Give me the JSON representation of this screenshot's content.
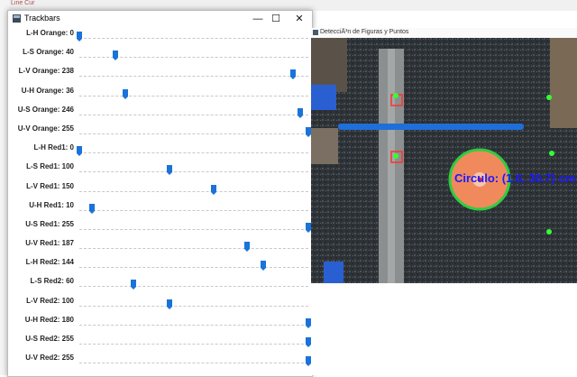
{
  "background": {
    "text": "Line  Cur"
  },
  "trackbars_window": {
    "title": "Trackbars",
    "controls": {
      "minimize": "—",
      "maximize": "☐",
      "close": "✕"
    },
    "sliders": [
      {
        "label": "L-H Orange: 0",
        "value": 0,
        "max": 179
      },
      {
        "label": "L-S Orange: 40",
        "value": 40,
        "max": 255
      },
      {
        "label": "L-V Orange: 238",
        "value": 238,
        "max": 255
      },
      {
        "label": "U-H Orange: 36",
        "value": 36,
        "max": 179
      },
      {
        "label": "U-S Orange: 246",
        "value": 246,
        "max": 255
      },
      {
        "label": "U-V Orange: 255",
        "value": 255,
        "max": 255
      },
      {
        "label": "L-H Red1: 0",
        "value": 0,
        "max": 179
      },
      {
        "label": "L-S Red1: 100",
        "value": 100,
        "max": 255
      },
      {
        "label": "L-V Red1: 150",
        "value": 150,
        "max": 255
      },
      {
        "label": "U-H Red1: 10",
        "value": 10,
        "max": 179
      },
      {
        "label": "U-S Red1: 255",
        "value": 255,
        "max": 255
      },
      {
        "label": "U-V Red1: 187",
        "value": 187,
        "max": 255
      },
      {
        "label": "L-H Red2: 144",
        "value": 144,
        "max": 179
      },
      {
        "label": "L-S Red2: 60",
        "value": 60,
        "max": 255
      },
      {
        "label": "L-V Red2: 100",
        "value": 100,
        "max": 255
      },
      {
        "label": "U-H Red2: 180",
        "value": 180,
        "max": 180
      },
      {
        "label": "U-S Red2: 255",
        "value": 255,
        "max": 255
      },
      {
        "label": "U-V Red2: 255",
        "value": 255,
        "max": 255
      }
    ]
  },
  "detection_window": {
    "title": "DetecciÃ³n de Figuras y Puntos",
    "overlay_text": "Circulo: (1.6, 30.7) cm",
    "colors": {
      "circle_fill": "#f08a5d",
      "circle_ring": "#2ecc40",
      "text": "#1a1aff",
      "pipe": "#1e6fd9",
      "point": "#33ff33"
    }
  }
}
